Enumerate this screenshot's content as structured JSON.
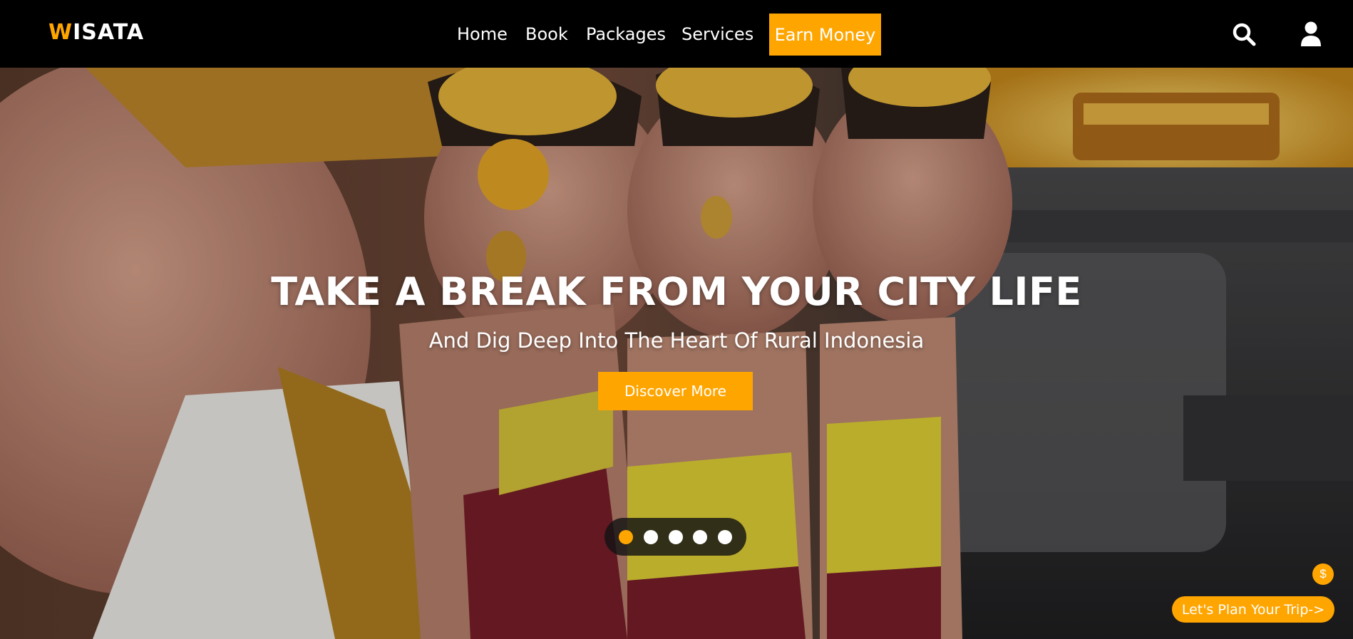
{
  "brand": {
    "first_letter": "W",
    "rest": "ISATA"
  },
  "nav": {
    "items": [
      "Home",
      "Book",
      "Packages",
      "Services"
    ],
    "cta": "Earn Money"
  },
  "icons": {
    "search": "search-icon",
    "user": "user-icon"
  },
  "hero": {
    "title": "TAKE A BREAK FROM YOUR CITY LIFE",
    "subtitle": "And Dig Deep Into The Heart Of Rural Indonesia",
    "button": "Discover More",
    "slide_count": 5,
    "active_slide": 1
  },
  "floating": {
    "coin_symbol": "$",
    "plan_button": "Let's Plan Your Trip->"
  },
  "colors": {
    "accent": "#ffa500",
    "navbar": "#000000",
    "text": "#ffffff"
  }
}
